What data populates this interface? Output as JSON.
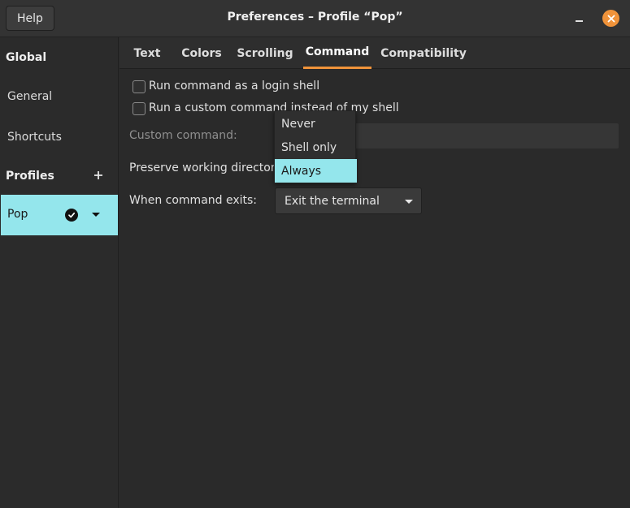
{
  "window": {
    "title": "Preferences – Profile “Pop”",
    "help_label": "Help"
  },
  "sidebar": {
    "global_heading": "Global",
    "items": [
      "General",
      "Shortcuts"
    ],
    "profiles_heading": "Profiles",
    "profile": "Pop"
  },
  "tabs": [
    "Text",
    "Colors",
    "Scrolling",
    "Command",
    "Compatibility"
  ],
  "active_tab": "Command",
  "command": {
    "login_shell_label": "Run command as a login shell",
    "custom_command_label": "Run a custom command instead of my shell",
    "custom_command_field_label": "Custom command:",
    "preserve_label": "Preserve working directory:",
    "exit_label": "When command exits:",
    "exit_value": "Exit the terminal"
  },
  "preserve_options": [
    "Never",
    "Shell only",
    "Always"
  ],
  "preserve_selected": "Always",
  "colors": {
    "accent": "#f0933a",
    "selection": "#94e6ec"
  }
}
